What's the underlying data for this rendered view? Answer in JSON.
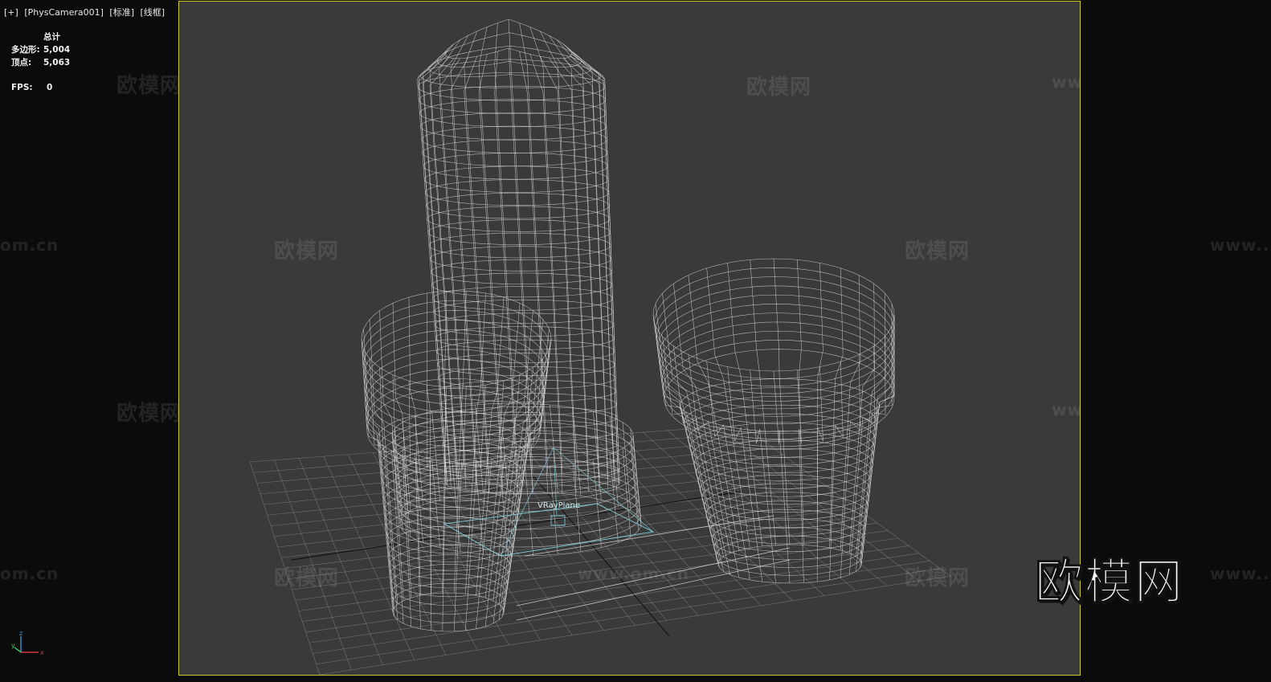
{
  "viewport": {
    "label_plus": "[+]",
    "label_camera": "[PhysCamera001]",
    "label_mode": "[标准]",
    "label_shading": "[线框]"
  },
  "stats": {
    "header": "总计",
    "polys_label": "多边形:",
    "polys_value": "5,004",
    "verts_label": "顶点:",
    "verts_value": "5,063",
    "fps_label": "FPS:",
    "fps_value": "0"
  },
  "scene": {
    "object_label": "VRayPlane"
  },
  "watermarks": {
    "brand_text": "欧模网",
    "url_text": "www.om.cn",
    "url_partial": "om.cn",
    "url_partial_right": "www..."
  },
  "axis_gizmo": {
    "x_label": "x",
    "y_label": "y",
    "z_label": "z"
  },
  "colors": {
    "viewport_bg": "#3a3a3a",
    "frame_border": "#c9c72a",
    "wire": "#e6e6e6",
    "light_wire": "#7fd3d8"
  }
}
